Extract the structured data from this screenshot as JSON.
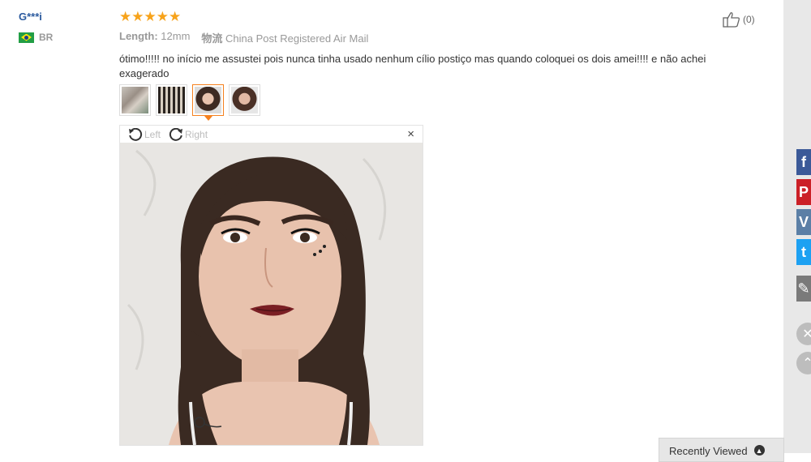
{
  "user": {
    "name": "G***i",
    "country": "BR",
    "flag_icon": "brazil-flag-icon"
  },
  "review": {
    "rating": 5,
    "stars": "★★★★★",
    "length_label": "Length:",
    "length_value": "12mm",
    "shipping_label": "物流",
    "shipping_value": "China Post Registered Air Mail",
    "text": "ótimo!!!!! no início me assustei pois nunca tinha usado nenhum cílio postiço mas quando coloquei os dois amei!!!! e não achei exagerado",
    "thumbnails": [
      "lashes-box-photo",
      "lashes-tray-photo",
      "selfie-photo-1",
      "selfie-photo-2"
    ],
    "active_thumbnail": 2
  },
  "viewer": {
    "rotate_left": "Left",
    "rotate_right": "Right",
    "close": "×"
  },
  "helpful": {
    "count": "(0)"
  },
  "sidebar": {
    "social": [
      "facebook-icon",
      "pinterest-icon",
      "vk-icon",
      "twitter-icon",
      "edit-icon"
    ],
    "colors": {
      "facebook": "#3b5998",
      "pinterest": "#cb2027",
      "vk": "#5b7fa6",
      "twitter": "#1da1f2"
    }
  },
  "recently_viewed": {
    "label": "Recently Viewed"
  },
  "colors": {
    "username": "#2b5a9e",
    "stars": "#f7a31b",
    "active_border": "#f5811f"
  }
}
